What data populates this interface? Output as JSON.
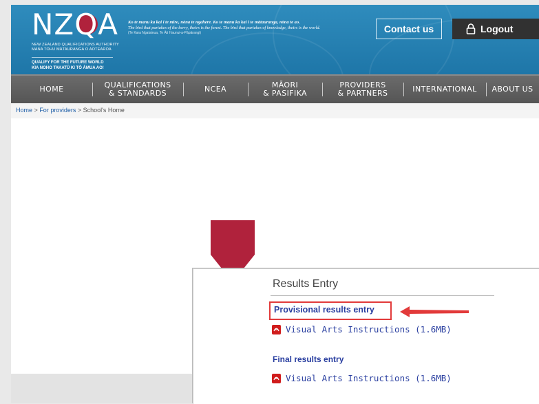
{
  "header": {
    "logo_text": "NZ",
    "logo_suffix": "A",
    "logo_q": "Q",
    "org_line1": "NEW ZEALAND QUALIFICATIONS AUTHORITY",
    "org_line2": "MANA TOHU MĀTAURANGA O AOTEAROA",
    "slogan_line1": "QUALIFY FOR THE FUTURE WORLD",
    "slogan_line2": "KIA NOHO TAKATŪ KI TŌ ĀMUA AO!",
    "proverb_maori": "Ko te manu ka kai i te miro, nōna te ngahere. Ko te manu ka kai i te mātauranga, nōna te ao.",
    "proverb_english": "The bird that partakes of the berry, theirs is the forest. The bird that partakes of knowledge, theirs is the world.",
    "proverb_attribution": "(Te Kara Ngatainua, Te Āti Haunui-a-Pāpārangi)",
    "contact_label": "Contact us",
    "logout_label": "Logout"
  },
  "nav": {
    "items": [
      {
        "line1": "HOME",
        "line2": ""
      },
      {
        "line1": "QUALIFICATIONS",
        "line2": "& STANDARDS"
      },
      {
        "line1": "NCEA",
        "line2": ""
      },
      {
        "line1": "MĀORI",
        "line2": "& PASIFIKA"
      },
      {
        "line1": "PROVIDERS",
        "line2": "& PARTNERS"
      },
      {
        "line1": "INTERNATIONAL",
        "line2": ""
      },
      {
        "line1": "ABOUT US",
        "line2": ""
      }
    ]
  },
  "breadcrumb": {
    "home": "Home",
    "providers": "For providers",
    "current": "School's Home",
    "separator": ">"
  },
  "results": {
    "title": "Results Entry",
    "provisional_link": "Provisional results entry",
    "provisional_pdf": "Visual Arts Instructions (1.6MB)",
    "final_link": "Final results entry",
    "final_pdf": "Visual Arts Instructions (1.6MB)"
  },
  "colors": {
    "header_blue": "#1e76a8",
    "nav_grey": "#5f5f5f",
    "marker_red": "#b0223c",
    "highlight_red": "#e23a3a",
    "link_blue": "#2a3fa0"
  }
}
